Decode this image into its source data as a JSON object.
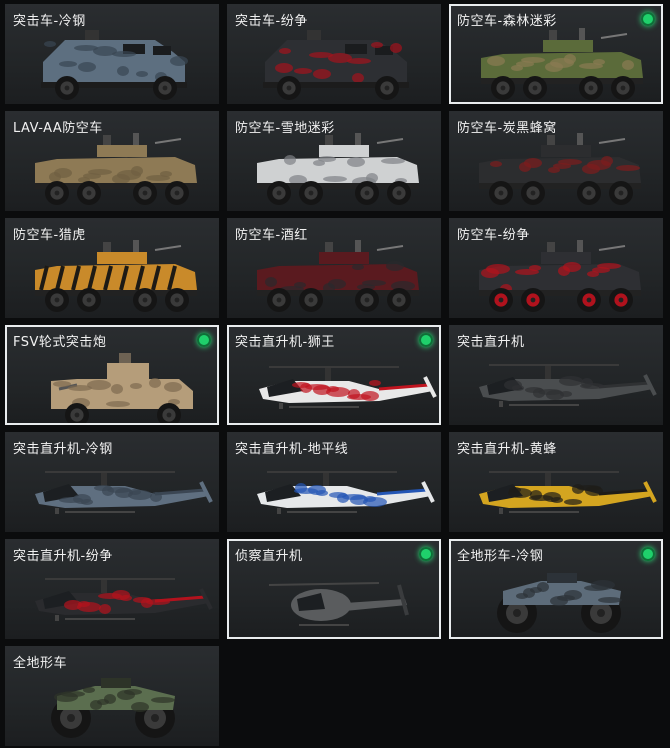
{
  "vehicles": [
    {
      "label": "突击车-冷钢",
      "kind": "truck",
      "selected": false,
      "owned": false,
      "body": "#5d6f80",
      "accent": "#394652"
    },
    {
      "label": "突击车-纷争",
      "kind": "truck",
      "selected": false,
      "owned": false,
      "body": "#2d2f33",
      "accent": "#a3121c"
    },
    {
      "label": "防空车-森林迷彩",
      "kind": "apc",
      "selected": true,
      "owned": true,
      "body": "#5b6b3a",
      "accent": "#8a7a52"
    },
    {
      "label": "LAV-AA防空车",
      "kind": "apc",
      "selected": false,
      "owned": false,
      "body": "#8e7a55",
      "accent": "#6f5f42"
    },
    {
      "label": "防空车-雪地迷彩",
      "kind": "apc",
      "selected": false,
      "owned": false,
      "body": "#cfd1d2",
      "accent": "#7f8286"
    },
    {
      "label": "防空车-炭黑蜂窝",
      "kind": "apc",
      "selected": false,
      "owned": false,
      "body": "#2c2d2f",
      "accent": "#7d1c1c"
    },
    {
      "label": "防空车-猎虎",
      "kind": "apc",
      "selected": false,
      "owned": false,
      "body": "#c98a2a",
      "accent": "#1d1a15"
    },
    {
      "label": "防空车-酒红",
      "kind": "apc",
      "selected": false,
      "owned": false,
      "body": "#5a1a1f",
      "accent": "#2a2a2c"
    },
    {
      "label": "防空车-纷争",
      "kind": "apc",
      "selected": false,
      "owned": false,
      "body": "#2e2f33",
      "accent": "#b0121d"
    },
    {
      "label": "FSV轮式突击炮",
      "kind": "fsv",
      "selected": true,
      "owned": true,
      "body": "#b59d7a",
      "accent": "#7e6a50"
    },
    {
      "label": "突击直升机-狮王",
      "kind": "heli",
      "selected": true,
      "owned": true,
      "body": "#e8e8e8",
      "accent": "#c0141f"
    },
    {
      "label": "突击直升机",
      "kind": "heli",
      "selected": false,
      "owned": false,
      "body": "#4a4d4f",
      "accent": "#2f3133"
    },
    {
      "label": "突击直升机-冷钢",
      "kind": "heli",
      "selected": false,
      "owned": false,
      "body": "#5f6f80",
      "accent": "#3b4653"
    },
    {
      "label": "突击直升机-地平线",
      "kind": "heli",
      "selected": false,
      "owned": false,
      "body": "#e6e8ea",
      "accent": "#2456b5"
    },
    {
      "label": "突击直升机-黄蜂",
      "kind": "heli",
      "selected": false,
      "owned": false,
      "body": "#d4a520",
      "accent": "#1e1c18"
    },
    {
      "label": "突击直升机-纷争",
      "kind": "heli",
      "selected": false,
      "owned": false,
      "body": "#2a2b2e",
      "accent": "#b3121d"
    },
    {
      "label": "侦察直升机",
      "kind": "scout",
      "selected": true,
      "owned": true,
      "body": "#5a5c5e",
      "accent": "#3a3c3e"
    },
    {
      "label": "全地形车-冷钢",
      "kind": "atv",
      "selected": true,
      "owned": true,
      "body": "#5d6c7a",
      "accent": "#2c3238"
    },
    {
      "label": "全地形车",
      "kind": "atv",
      "selected": false,
      "owned": false,
      "body": "#5b6e4f",
      "accent": "#2d3328"
    }
  ]
}
